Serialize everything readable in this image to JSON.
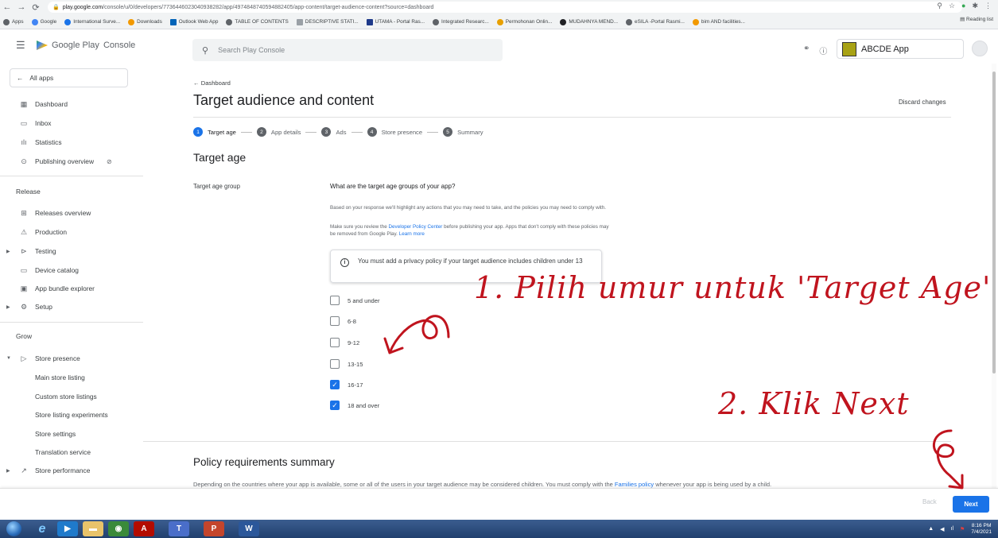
{
  "browser": {
    "url_domain": "play.google.com",
    "url_path": "/console/u/0/developers/7736446023040938282/app/4974848740594882405/app-content/target-audience-content?source=dashboard",
    "bookmarks": [
      "Apps",
      "Google",
      "International Surve...",
      "Downloads",
      "Outlook Web App",
      "TABLE OF CONTENTS",
      "DESCRIPTIVE STATI...",
      "UTAMA - Portal Ras...",
      "Integrated Researc...",
      "Permohonan Onlin...",
      "MUDAHNYA MEND...",
      "eSILA -Portal Rasmi...",
      "bim AND facilities..."
    ],
    "reading_list": "Reading list"
  },
  "header": {
    "logo_text": "Google Play",
    "logo_suffix": "Console",
    "search_placeholder": "Search Play Console",
    "app_name": "ABCDE App"
  },
  "sidebar": {
    "all_apps": "All apps",
    "items_top": [
      "Dashboard",
      "Inbox",
      "Statistics",
      "Publishing overview"
    ],
    "release_heading": "Release",
    "release_items": [
      "Releases overview",
      "Production",
      "Testing",
      "Device catalog",
      "App bundle explorer",
      "Setup"
    ],
    "grow_heading": "Grow",
    "grow_items": [
      "Store presence",
      "Main store listing",
      "Custom store listings",
      "Store listing experiments",
      "Store settings",
      "Translation service",
      "Store performance"
    ]
  },
  "main": {
    "breadcrumb": "← Dashboard",
    "title": "Target audience and content",
    "discard": "Discard changes",
    "steps": [
      {
        "num": "1",
        "label": "Target age"
      },
      {
        "num": "2",
        "label": "App details"
      },
      {
        "num": "3",
        "label": "Ads"
      },
      {
        "num": "4",
        "label": "Store presence"
      },
      {
        "num": "5",
        "label": "Summary"
      }
    ],
    "section_title": "Target age",
    "field_label": "Target age group",
    "question": "What are the target age groups of your app?",
    "para1": "Based on your response we'll highlight any actions that you may need to take, and the policies you may need to comply with.",
    "para2_a": "Make sure you review the",
    "para2_link": "Developer Policy Center",
    "para2_b": "before publishing your app. Apps that don't comply with these policies may be removed from Google Play.",
    "para2_link2": "Learn more",
    "info": "You must add a privacy policy if your target audience includes children under 13",
    "age_options": [
      {
        "label": "5 and under",
        "checked": false
      },
      {
        "label": "6-8",
        "checked": false
      },
      {
        "label": "9-12",
        "checked": false
      },
      {
        "label": "13-15",
        "checked": false
      },
      {
        "label": "16-17",
        "checked": true
      },
      {
        "label": "18 and over",
        "checked": true
      }
    ],
    "policy_title": "Policy requirements summary",
    "policy_text_a": "Depending on the countries where your app is available, some or all of the users in your target audience may be considered children. You must comply with the",
    "policy_link": "Families policy",
    "policy_text_b": "whenever your app is being used by a child."
  },
  "footer": {
    "back": "Back",
    "next": "Next"
  },
  "annotations": {
    "note1": "1. Pilih umur untuk 'Target Age'",
    "note2": "2. Klik Next",
    "color": "#c0141e"
  },
  "taskbar": {
    "time": "8:16 PM",
    "date": "7/4/2021"
  },
  "colors": {
    "accent": "#1a73e8",
    "annotation": "#c0141e"
  }
}
